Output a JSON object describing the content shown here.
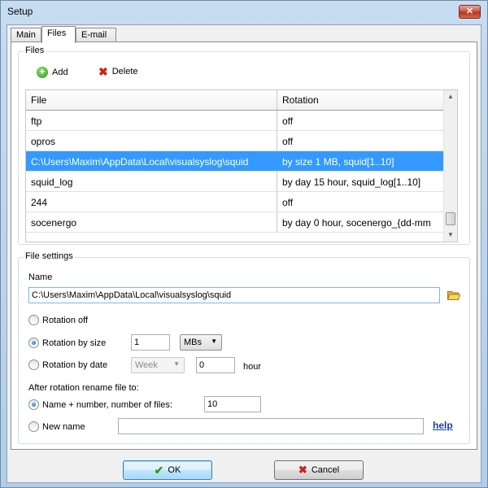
{
  "window": {
    "title": "Setup",
    "close_glyph": "✕"
  },
  "tabs": [
    {
      "label": "Main"
    },
    {
      "label": "Files"
    },
    {
      "label": "E-mail"
    }
  ],
  "files_group": {
    "legend": "Files",
    "add_label": "Add",
    "delete_label": "Delete",
    "columns": {
      "file": "File",
      "rotation": "Rotation"
    },
    "rows": [
      {
        "file": "ftp",
        "rotation": "off"
      },
      {
        "file": "opros",
        "rotation": "off"
      },
      {
        "file": "C:\\Users\\Maxim\\AppData\\Local\\visualsyslog\\squid",
        "rotation": "by size 1 MB, squid[1..10]"
      },
      {
        "file": "squid_log",
        "rotation": "by day 15 hour, squid_log[1..10]"
      },
      {
        "file": "244",
        "rotation": "off"
      },
      {
        "file": "socenergo",
        "rotation": "by day 0 hour, socenergo_{dd-mm"
      }
    ],
    "selected_index": 2
  },
  "settings_group": {
    "legend": "File settings",
    "name_label": "Name",
    "name_value": "C:\\Users\\Maxim\\AppData\\Local\\visualsyslog\\squid",
    "rotation_off_label": "Rotation off",
    "rotation_size_label": "Rotation by size",
    "size_value": "1",
    "size_unit": "MBs",
    "rotation_date_label": "Rotation by date",
    "date_period": "Week",
    "date_hour_value": "0",
    "hour_label": "hour",
    "rename_label": "After rotation rename file to:",
    "name_number_label": "Name + number, number of files:",
    "files_count": "10",
    "new_name_label": "New name",
    "new_name_value": "",
    "help_label": "help"
  },
  "buttons": {
    "ok_label": "OK",
    "cancel_label": "Cancel"
  },
  "colors": {
    "selection": "#3399ff",
    "add_icon": "#2f9a1b",
    "delete_icon": "#d11e1e"
  }
}
